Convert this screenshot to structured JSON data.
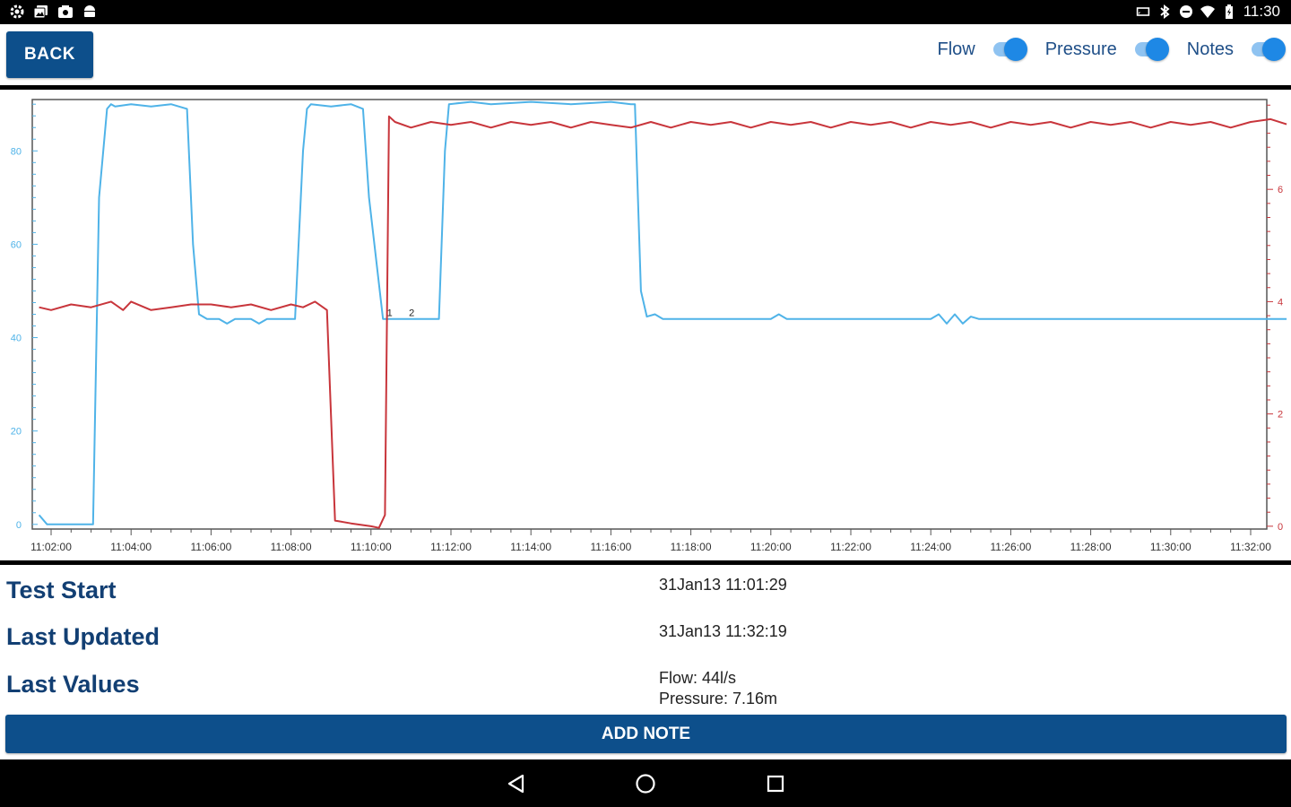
{
  "status_bar": {
    "left_icons": [
      "settings-notification-icon",
      "photos-notification-icon",
      "camera-notification-icon",
      "android-notification-icon"
    ],
    "right_icons": [
      "cast-icon",
      "bluetooth-icon",
      "do-not-disturb-icon",
      "wifi-icon",
      "battery-charging-icon"
    ],
    "time": "11:30"
  },
  "toolbar": {
    "back_label": "BACK",
    "toggles": [
      {
        "label": "Flow",
        "on": true
      },
      {
        "label": "Pressure",
        "on": true
      },
      {
        "label": "Notes",
        "on": true
      }
    ]
  },
  "colors": {
    "flow": "#4fb3e8",
    "pressure": "#c8353b",
    "primary": "#0d4f8b",
    "label": "#123f73"
  },
  "chart_data": {
    "type": "line",
    "x_ticks": [
      "11:02:00",
      "11:04:00",
      "11:06:00",
      "11:08:00",
      "11:10:00",
      "11:12:00",
      "11:14:00",
      "11:16:00",
      "11:18:00",
      "11:20:00",
      "11:22:00",
      "11:24:00",
      "11:26:00",
      "11:28:00",
      "11:30:00",
      "11:32:00"
    ],
    "x_range_minutes": [
      0,
      31
    ],
    "y_left": {
      "ticks": [
        "0",
        "20",
        "40",
        "60",
        "80"
      ],
      "range": [
        -1,
        91
      ],
      "color": "#4fb3e8"
    },
    "y_right": {
      "ticks": [
        "0",
        "2",
        "4",
        "6"
      ],
      "range": [
        -0.05,
        7.6
      ],
      "color": "#c8353b"
    },
    "series": [
      {
        "axis": "left",
        "color": "#4fb3e8",
        "points": [
          [
            -0.3,
            2
          ],
          [
            -0.1,
            0
          ],
          [
            1.0,
            0
          ],
          [
            1.05,
            0
          ],
          [
            1.2,
            70
          ],
          [
            1.4,
            89
          ],
          [
            1.5,
            90
          ],
          [
            1.6,
            89.5
          ],
          [
            2.0,
            90
          ],
          [
            2.5,
            89.5
          ],
          [
            3.0,
            90
          ],
          [
            3.4,
            89
          ],
          [
            3.55,
            60
          ],
          [
            3.7,
            45
          ],
          [
            3.9,
            44
          ],
          [
            4.2,
            44
          ],
          [
            4.4,
            43
          ],
          [
            4.6,
            44
          ],
          [
            5.0,
            44
          ],
          [
            5.2,
            43
          ],
          [
            5.4,
            44
          ],
          [
            6.0,
            44
          ],
          [
            6.1,
            44
          ],
          [
            6.3,
            80
          ],
          [
            6.4,
            89
          ],
          [
            6.5,
            90
          ],
          [
            7.0,
            89.5
          ],
          [
            7.5,
            90
          ],
          [
            7.8,
            89
          ],
          [
            7.95,
            70
          ],
          [
            8.3,
            44
          ],
          [
            9.5,
            44
          ],
          [
            9.7,
            44
          ],
          [
            9.85,
            80
          ],
          [
            9.95,
            90
          ],
          [
            10.5,
            90.5
          ],
          [
            11.0,
            90
          ],
          [
            12.0,
            90.5
          ],
          [
            13.0,
            90
          ],
          [
            14.0,
            90.5
          ],
          [
            14.5,
            90
          ],
          [
            14.6,
            90
          ],
          [
            14.75,
            50
          ],
          [
            14.9,
            44.5
          ],
          [
            15.1,
            45
          ],
          [
            15.3,
            44
          ],
          [
            18.0,
            44
          ],
          [
            18.2,
            45
          ],
          [
            18.4,
            44
          ],
          [
            22.0,
            44
          ],
          [
            22.2,
            45
          ],
          [
            22.4,
            43
          ],
          [
            22.6,
            45
          ],
          [
            22.8,
            43
          ],
          [
            23.0,
            44.5
          ],
          [
            23.2,
            44
          ],
          [
            30.9,
            44
          ]
        ]
      },
      {
        "axis": "right",
        "color": "#c8353b",
        "points": [
          [
            -0.3,
            3.9
          ],
          [
            0.0,
            3.85
          ],
          [
            0.5,
            3.95
          ],
          [
            1.0,
            3.9
          ],
          [
            1.5,
            4.0
          ],
          [
            1.8,
            3.85
          ],
          [
            2.0,
            4.0
          ],
          [
            2.5,
            3.85
          ],
          [
            3.0,
            3.9
          ],
          [
            3.5,
            3.95
          ],
          [
            4.0,
            3.95
          ],
          [
            4.5,
            3.9
          ],
          [
            5.0,
            3.95
          ],
          [
            5.5,
            3.85
          ],
          [
            6.0,
            3.95
          ],
          [
            6.3,
            3.9
          ],
          [
            6.6,
            4.0
          ],
          [
            6.9,
            3.85
          ],
          [
            7.1,
            0.1
          ],
          [
            7.5,
            0.05
          ],
          [
            8.0,
            0.0
          ],
          [
            8.2,
            -0.03
          ],
          [
            8.35,
            0.2
          ],
          [
            8.45,
            7.3
          ],
          [
            8.6,
            7.2
          ],
          [
            9.0,
            7.1
          ],
          [
            9.5,
            7.2
          ],
          [
            10.0,
            7.15
          ],
          [
            10.5,
            7.2
          ],
          [
            11.0,
            7.1
          ],
          [
            11.5,
            7.2
          ],
          [
            12.0,
            7.15
          ],
          [
            12.5,
            7.2
          ],
          [
            13.0,
            7.1
          ],
          [
            13.5,
            7.2
          ],
          [
            14.0,
            7.15
          ],
          [
            14.5,
            7.1
          ],
          [
            15.0,
            7.2
          ],
          [
            15.5,
            7.1
          ],
          [
            16.0,
            7.2
          ],
          [
            16.5,
            7.15
          ],
          [
            17.0,
            7.2
          ],
          [
            17.5,
            7.1
          ],
          [
            18.0,
            7.2
          ],
          [
            18.5,
            7.15
          ],
          [
            19.0,
            7.2
          ],
          [
            19.5,
            7.1
          ],
          [
            20.0,
            7.2
          ],
          [
            20.5,
            7.15
          ],
          [
            21.0,
            7.2
          ],
          [
            21.5,
            7.1
          ],
          [
            22.0,
            7.2
          ],
          [
            22.5,
            7.15
          ],
          [
            23.0,
            7.2
          ],
          [
            23.5,
            7.1
          ],
          [
            24.0,
            7.2
          ],
          [
            24.5,
            7.15
          ],
          [
            25.0,
            7.2
          ],
          [
            25.5,
            7.1
          ],
          [
            26.0,
            7.2
          ],
          [
            26.5,
            7.15
          ],
          [
            27.0,
            7.2
          ],
          [
            27.5,
            7.1
          ],
          [
            28.0,
            7.2
          ],
          [
            28.5,
            7.15
          ],
          [
            29.0,
            7.2
          ],
          [
            29.5,
            7.1
          ],
          [
            30.0,
            7.2
          ],
          [
            30.5,
            7.25
          ],
          [
            30.9,
            7.16
          ]
        ]
      }
    ],
    "notes": [
      {
        "label": "1",
        "x": 8.4,
        "y": 44
      },
      {
        "label": "2",
        "x": 8.95,
        "y": 44
      }
    ]
  },
  "info": {
    "test_start_label": "Test Start",
    "test_start_value": "31Jan13 11:01:29",
    "last_updated_label": "Last Updated",
    "last_updated_value": "31Jan13 11:32:19",
    "last_values_label": "Last Values",
    "last_values_flow": "Flow: 44l/s",
    "last_values_pressure": "Pressure: 7.16m"
  },
  "add_note_label": "ADD NOTE",
  "nav": {
    "icons": [
      "back-nav-icon",
      "home-nav-icon",
      "recents-nav-icon"
    ]
  }
}
